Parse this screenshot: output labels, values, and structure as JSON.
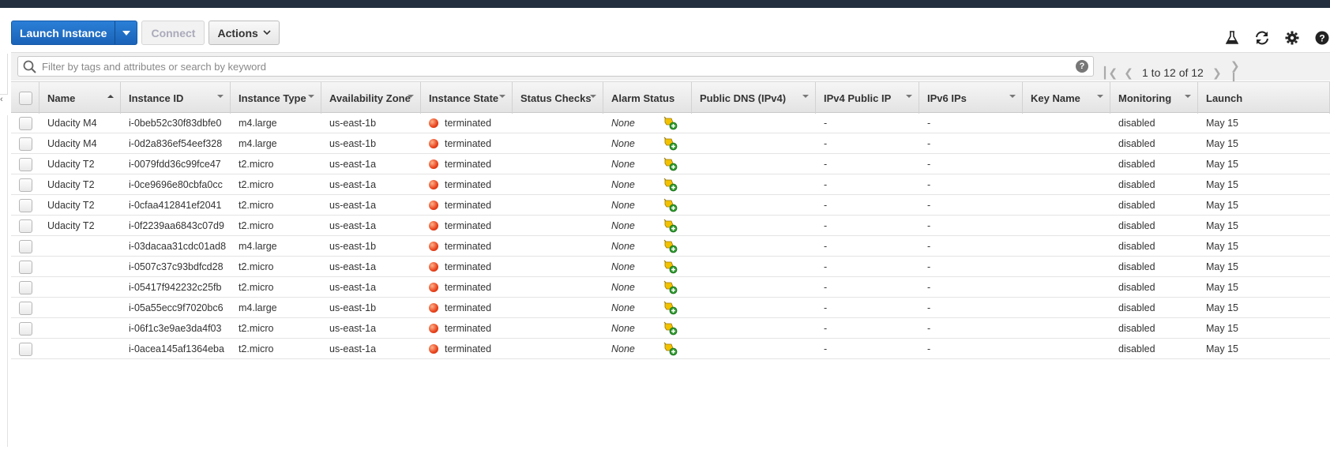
{
  "toolbar": {
    "launch_label": "Launch Instance",
    "connect_label": "Connect",
    "actions_label": "Actions"
  },
  "tools": [
    "lab-icon",
    "refresh-icon",
    "gear-icon",
    "help-icon"
  ],
  "search": {
    "placeholder": "Filter by tags and attributes or search by keyword",
    "value": ""
  },
  "pager": {
    "text": "1 to 12 of 12"
  },
  "columns": [
    {
      "label": "Name",
      "sort": "asc"
    },
    {
      "label": "Instance ID"
    },
    {
      "label": "Instance Type"
    },
    {
      "label": "Availability Zone"
    },
    {
      "label": "Instance State"
    },
    {
      "label": "Status Checks"
    },
    {
      "label": "Alarm Status"
    },
    {
      "label": "Public DNS (IPv4)"
    },
    {
      "label": "IPv4 Public IP"
    },
    {
      "label": "IPv6 IPs"
    },
    {
      "label": "Key Name"
    },
    {
      "label": "Monitoring"
    },
    {
      "label": "Launch"
    }
  ],
  "rows": [
    {
      "name": "Udacity M4",
      "id": "i-0beb52c30f83dbfe0",
      "type": "m4.large",
      "az": "us-east-1b",
      "state": "terminated",
      "alarm": "None",
      "dns": "",
      "ipv4": "-",
      "ipv6": "-",
      "key": "",
      "monitoring": "disabled",
      "launch": "May 15"
    },
    {
      "name": "Udacity M4",
      "id": "i-0d2a836ef54eef328",
      "type": "m4.large",
      "az": "us-east-1b",
      "state": "terminated",
      "alarm": "None",
      "dns": "",
      "ipv4": "-",
      "ipv6": "-",
      "key": "",
      "monitoring": "disabled",
      "launch": "May 15"
    },
    {
      "name": "Udacity T2",
      "id": "i-0079fdd36c99fce47",
      "type": "t2.micro",
      "az": "us-east-1a",
      "state": "terminated",
      "alarm": "None",
      "dns": "",
      "ipv4": "-",
      "ipv6": "-",
      "key": "",
      "monitoring": "disabled",
      "launch": "May 15"
    },
    {
      "name": "Udacity T2",
      "id": "i-0ce9696e80cbfa0cc",
      "type": "t2.micro",
      "az": "us-east-1a",
      "state": "terminated",
      "alarm": "None",
      "dns": "",
      "ipv4": "-",
      "ipv6": "-",
      "key": "",
      "monitoring": "disabled",
      "launch": "May 15"
    },
    {
      "name": "Udacity T2",
      "id": "i-0cfaa412841ef2041",
      "type": "t2.micro",
      "az": "us-east-1a",
      "state": "terminated",
      "alarm": "None",
      "dns": "",
      "ipv4": "-",
      "ipv6": "-",
      "key": "",
      "monitoring": "disabled",
      "launch": "May 15"
    },
    {
      "name": "Udacity T2",
      "id": "i-0f2239aa6843c07d9",
      "type": "t2.micro",
      "az": "us-east-1a",
      "state": "terminated",
      "alarm": "None",
      "dns": "",
      "ipv4": "-",
      "ipv6": "-",
      "key": "",
      "monitoring": "disabled",
      "launch": "May 15"
    },
    {
      "name": "",
      "id": "i-03dacaa31cdc01ad8",
      "type": "m4.large",
      "az": "us-east-1b",
      "state": "terminated",
      "alarm": "None",
      "dns": "",
      "ipv4": "-",
      "ipv6": "-",
      "key": "",
      "monitoring": "disabled",
      "launch": "May 15"
    },
    {
      "name": "",
      "id": "i-0507c37c93bdfcd28",
      "type": "t2.micro",
      "az": "us-east-1a",
      "state": "terminated",
      "alarm": "None",
      "dns": "",
      "ipv4": "-",
      "ipv6": "-",
      "key": "",
      "monitoring": "disabled",
      "launch": "May 15"
    },
    {
      "name": "",
      "id": "i-05417f942232c25fb",
      "type": "t2.micro",
      "az": "us-east-1a",
      "state": "terminated",
      "alarm": "None",
      "dns": "",
      "ipv4": "-",
      "ipv6": "-",
      "key": "",
      "monitoring": "disabled",
      "launch": "May 15"
    },
    {
      "name": "",
      "id": "i-05a55ecc9f7020bc6",
      "type": "m4.large",
      "az": "us-east-1b",
      "state": "terminated",
      "alarm": "None",
      "dns": "",
      "ipv4": "-",
      "ipv6": "-",
      "key": "",
      "monitoring": "disabled",
      "launch": "May 15"
    },
    {
      "name": "",
      "id": "i-06f1c3e9ae3da4f03",
      "type": "t2.micro",
      "az": "us-east-1a",
      "state": "terminated",
      "alarm": "None",
      "dns": "",
      "ipv4": "-",
      "ipv6": "-",
      "key": "",
      "monitoring": "disabled",
      "launch": "May 15"
    },
    {
      "name": "",
      "id": "i-0acea145af1364eba",
      "type": "t2.micro",
      "az": "us-east-1a",
      "state": "terminated",
      "alarm": "None",
      "dns": "",
      "ipv4": "-",
      "ipv6": "-",
      "key": "",
      "monitoring": "disabled",
      "launch": "May 15"
    }
  ],
  "colors": {
    "primary": "#1a63b8",
    "topbar": "#232f3e",
    "terminated": "#e8421b"
  }
}
